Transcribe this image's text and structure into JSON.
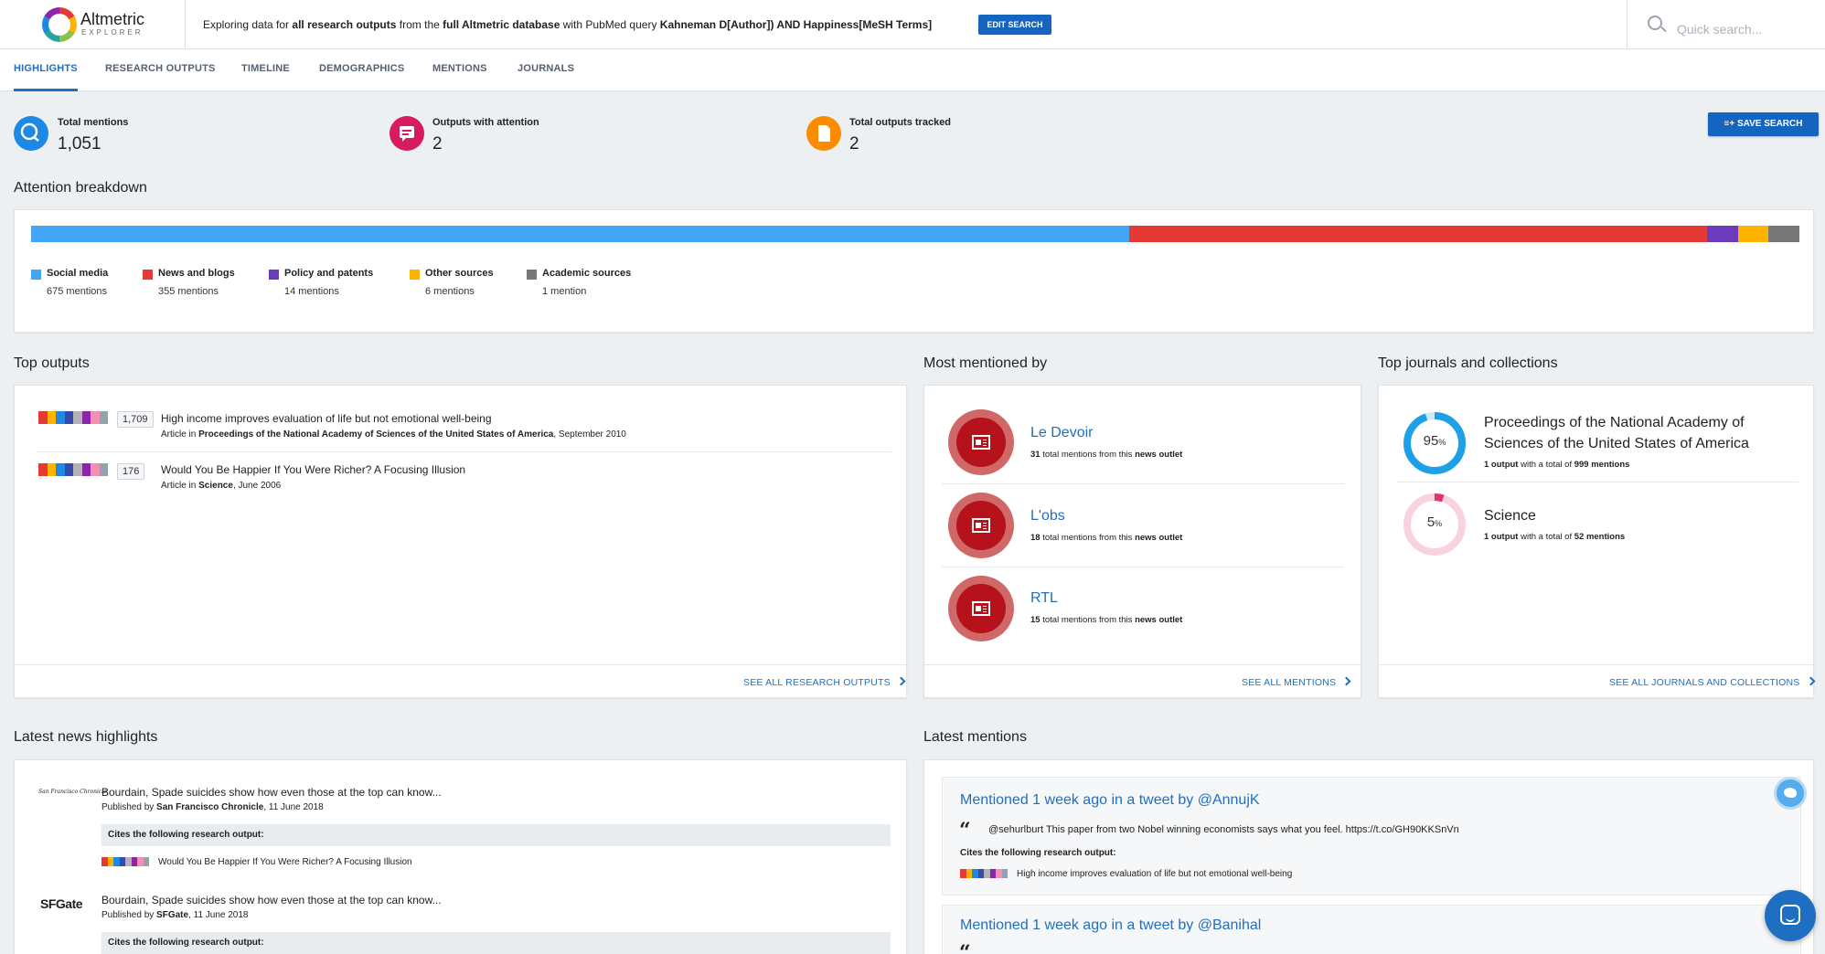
{
  "app": {
    "name": "Altmetric",
    "subtitle": "EXPLORER"
  },
  "header": {
    "explore_pre": "Exploring data for ",
    "explore_b1": "all research outputs",
    "explore_mid1": " from the ",
    "explore_b2": "full Altmetric database",
    "explore_mid2": " with PubMed query ",
    "explore_b3": "Kahneman D[Author]) AND Happiness[MeSH Terms]",
    "edit_label": "EDIT SEARCH",
    "search_placeholder": "Quick search..."
  },
  "tabs": [
    {
      "label": "HIGHLIGHTS"
    },
    {
      "label": "RESEARCH OUTPUTS"
    },
    {
      "label": "TIMELINE"
    },
    {
      "label": "DEMOGRAPHICS"
    },
    {
      "label": "MENTIONS"
    },
    {
      "label": "JOURNALS"
    }
  ],
  "stats": [
    {
      "label": "Total mentions",
      "value": "1,051",
      "color": "#1e88e5"
    },
    {
      "label": "Outputs with attention",
      "value": "2",
      "color": "#d81b60"
    },
    {
      "label": "Total outputs tracked",
      "value": "2",
      "color": "#fb8c00"
    }
  ],
  "save_label": "SAVE SEARCH",
  "attention": {
    "title": "Attention breakdown",
    "segments": [
      {
        "name": "Social media",
        "count": "675 mentions",
        "value": 675,
        "color": "#42a5f5"
      },
      {
        "name": "News and blogs",
        "count": "355 mentions",
        "value": 355,
        "color": "#e53935"
      },
      {
        "name": "Policy and patents",
        "count": "14 mentions",
        "value": 14,
        "color": "#6a3cbc"
      },
      {
        "name": "Other sources",
        "count": "6 mentions",
        "value": 6,
        "color": "#ffb300"
      },
      {
        "name": "Academic sources",
        "count": "1 mention",
        "value": 1,
        "color": "#777777"
      }
    ]
  },
  "top_outputs": {
    "title": "Top outputs",
    "items": [
      {
        "score": "1,709",
        "title": "High income improves evaluation of life but not emotional well-being",
        "type": "Article in ",
        "journal": "Proceedings of the National Academy of Sciences of the United States of America",
        "date": ", September 2010"
      },
      {
        "score": "176",
        "title": "Would You Be Happier If You Were Richer? A Focusing Illusion",
        "type": "Article in ",
        "journal": "Science",
        "date": ", June 2006"
      }
    ],
    "see_all": "SEE ALL RESEARCH OUTPUTS"
  },
  "most_mentioned": {
    "title": "Most mentioned by",
    "items": [
      {
        "name": "Le Devoir",
        "count": "31",
        "pre": " total mentions from this ",
        "kind": "news outlet"
      },
      {
        "name": "L'obs",
        "count": "18",
        "pre": " total mentions from this ",
        "kind": "news outlet"
      },
      {
        "name": "RTL",
        "count": "15",
        "pre": " total mentions from this ",
        "kind": "news outlet"
      }
    ],
    "see_all": "SEE ALL MENTIONS"
  },
  "journals": {
    "title": "Top journals and collections",
    "items": [
      {
        "pct": 95,
        "pct_label": "95",
        "name": "Proceedings of the National Academy of Sciences of the United States of America",
        "outputs": "1 output",
        "mid": " with a total of ",
        "mentions": "999 mentions",
        "color": "#1ea0e6"
      },
      {
        "pct": 5,
        "pct_label": "5",
        "name": "Science",
        "outputs": "1 output",
        "mid": " with a total of ",
        "mentions": "52 mentions",
        "color": "#e2336f"
      }
    ],
    "pct_unit": "%",
    "see_all": "SEE ALL JOURNALS AND COLLECTIONS"
  },
  "news": {
    "title": "Latest news highlights",
    "items": [
      {
        "logo": "San Francisco Chronicle",
        "title": "Bourdain, Spade suicides show how even those at the top can know...",
        "pre": "Published by ",
        "source": "San Francisco Chronicle",
        "date": ", 11 June 2018",
        "cites": "Cites the following research output:",
        "cited": "Would You Be Happier If You Were Richer? A Focusing Illusion"
      },
      {
        "logo": "SFGate",
        "title": "Bourdain, Spade suicides show how even those at the top can know...",
        "pre": "Published by ",
        "source": "SFGate",
        "date": ", 11 June 2018",
        "cites": "Cites the following research output:"
      }
    ]
  },
  "latest_mentions": {
    "title": "Latest mentions",
    "items": [
      {
        "head": "Mentioned 1 week ago in a tweet by @AnnujK",
        "text": "@sehurlburt This paper from two Nobel winning economists says what you feel. https://t.co/GH90KKSnVn",
        "cites": "Cites the following research output:",
        "cited": "High income improves evaluation of life but not emotional well-being"
      },
      {
        "head": "Mentioned 1 week ago in a tweet by @Banihal"
      }
    ]
  }
}
